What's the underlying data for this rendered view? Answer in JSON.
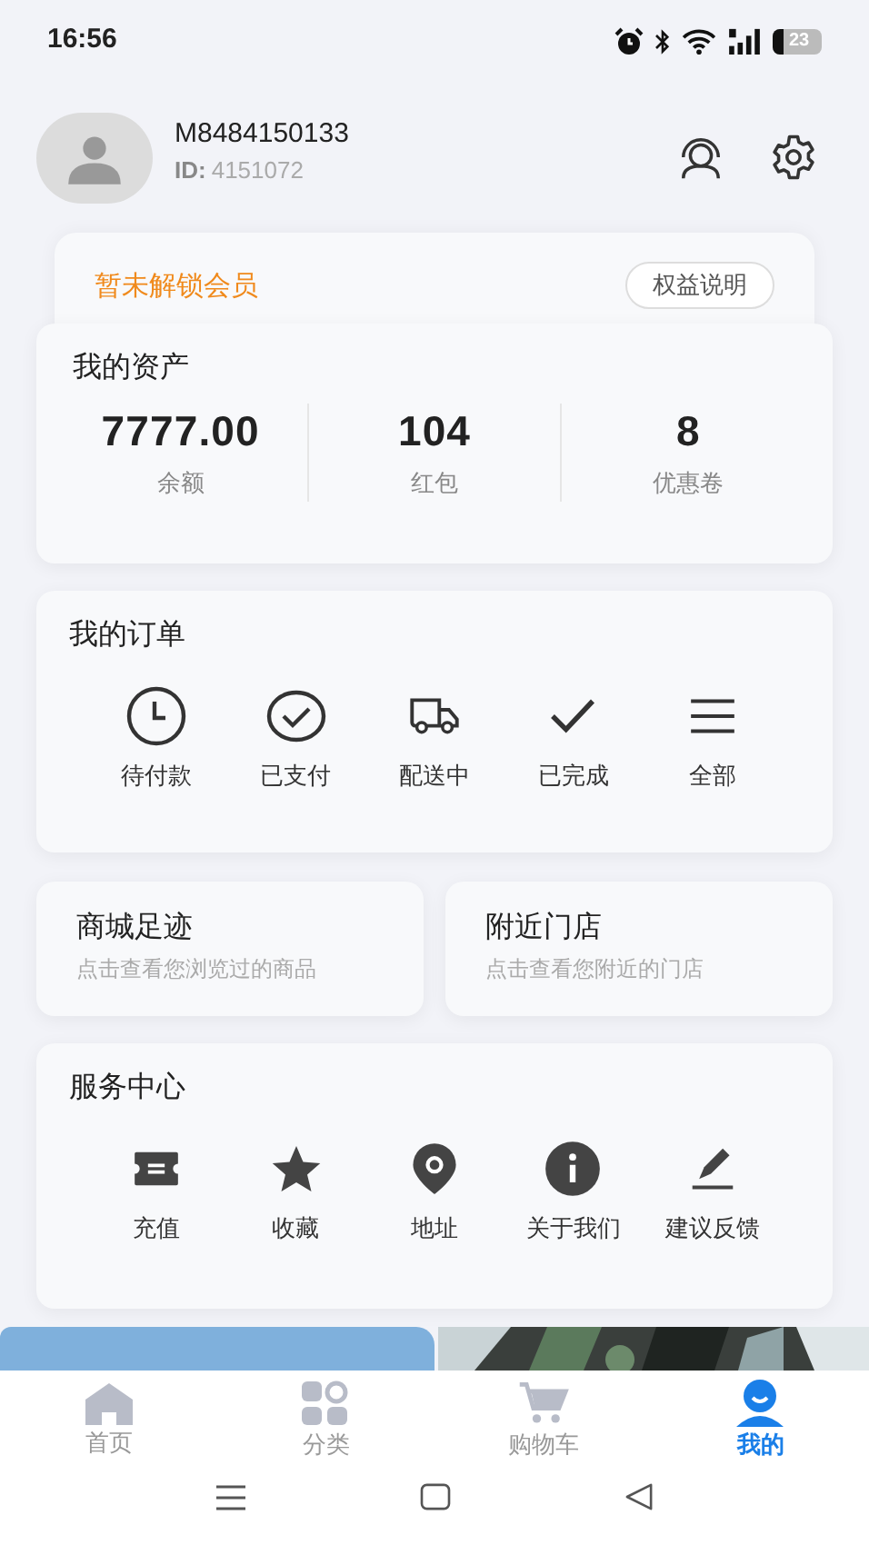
{
  "status_bar": {
    "time": "16:56",
    "battery": "23"
  },
  "profile": {
    "name": "M8484150133",
    "id_label": "ID:",
    "id": "4151072"
  },
  "membership": {
    "text": "暂未解锁会员",
    "button": "权益说明"
  },
  "assets": {
    "title": "我的资产",
    "items": [
      {
        "value": "7777.00",
        "label": "余额"
      },
      {
        "value": "104",
        "label": "红包"
      },
      {
        "value": "8",
        "label": "优惠卷"
      }
    ]
  },
  "orders": {
    "title": "我的订单",
    "items": [
      {
        "kind": "clock",
        "label": "待付款"
      },
      {
        "kind": "check-circle",
        "label": "已支付"
      },
      {
        "kind": "truck",
        "label": "配送中"
      },
      {
        "kind": "check",
        "label": "已完成"
      },
      {
        "kind": "list",
        "label": "全部"
      }
    ]
  },
  "shortcuts": [
    {
      "title": "商城足迹",
      "subtitle": "点击查看您浏览过的商品"
    },
    {
      "title": "附近门店",
      "subtitle": "点击查看您附近的门店"
    }
  ],
  "services": {
    "title": "服务中心",
    "items": [
      {
        "kind": "ticket",
        "label": "充值"
      },
      {
        "kind": "star",
        "label": "收藏"
      },
      {
        "kind": "pin",
        "label": "地址"
      },
      {
        "kind": "info",
        "label": "关于我们"
      },
      {
        "kind": "pen",
        "label": "建议反馈"
      }
    ]
  },
  "banners": [
    {
      "kind": "plain"
    },
    {
      "kind": "picture"
    }
  ],
  "tab_bar": [
    {
      "kind": "home",
      "label": "首页",
      "selected": false
    },
    {
      "kind": "category",
      "label": "分类",
      "selected": false
    },
    {
      "kind": "cart",
      "label": "购物车",
      "selected": false
    },
    {
      "kind": "me",
      "label": "我的",
      "selected": true
    }
  ]
}
